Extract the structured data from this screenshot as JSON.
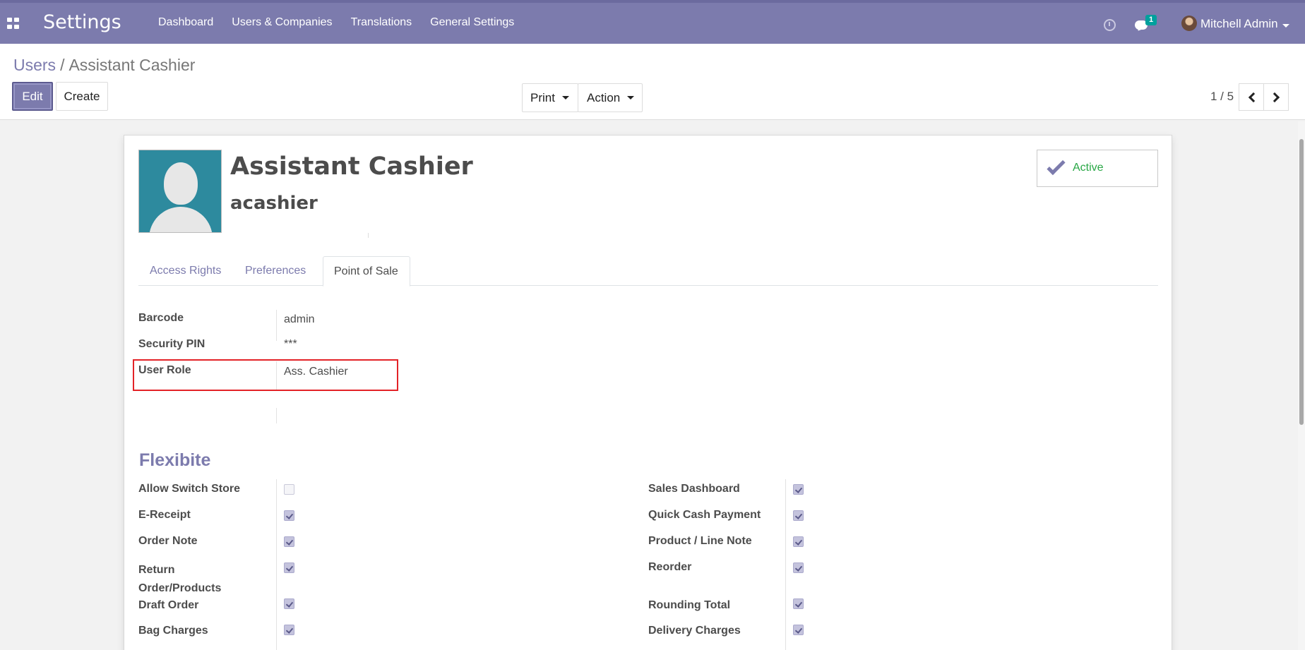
{
  "app": {
    "title": "Settings",
    "menu": [
      "Dashboard",
      "Users & Companies",
      "Translations",
      "General Settings"
    ],
    "notification_count": "1",
    "user_name": "Mitchell Admin"
  },
  "breadcrumb": {
    "parent": "Users",
    "separator": "/",
    "current": "Assistant Cashier"
  },
  "toolbar": {
    "edit": "Edit",
    "create": "Create",
    "print": "Print",
    "action": "Action"
  },
  "pager": {
    "value": "1 / 5"
  },
  "record": {
    "name": "Assistant Cashier",
    "login": "acashier",
    "status": "Active"
  },
  "tabs": [
    "Access Rights",
    "Preferences",
    "Point of Sale"
  ],
  "active_tab": "Point of Sale",
  "pos_fields": {
    "barcode_label": "Barcode",
    "barcode_value": "admin",
    "pin_label": "Security PIN",
    "pin_value": "***",
    "role_label": "User Role",
    "role_value": "Ass. Cashier"
  },
  "flexibite": {
    "title": "Flexibite",
    "left": [
      {
        "label": "Allow Switch Store",
        "checked": false
      },
      {
        "label": "E-Receipt",
        "checked": true
      },
      {
        "label": "Order Note",
        "checked": true
      },
      {
        "label": "Return Order/Products",
        "checked": true
      },
      {
        "label": "Draft Order",
        "checked": true
      },
      {
        "label": "Bag Charges",
        "checked": true
      }
    ],
    "right": [
      {
        "label": "Sales Dashboard",
        "checked": true
      },
      {
        "label": "Quick Cash Payment",
        "checked": true
      },
      {
        "label": "Product / Line Note",
        "checked": true
      },
      {
        "label": "Reorder",
        "checked": true
      },
      {
        "label": "Rounding Total",
        "checked": true
      },
      {
        "label": "Delivery Charges",
        "checked": true
      }
    ]
  },
  "colors": {
    "brand": "#7c7bad",
    "active": "#28a745",
    "highlight": "#e32227",
    "badge": "#00a09d"
  }
}
